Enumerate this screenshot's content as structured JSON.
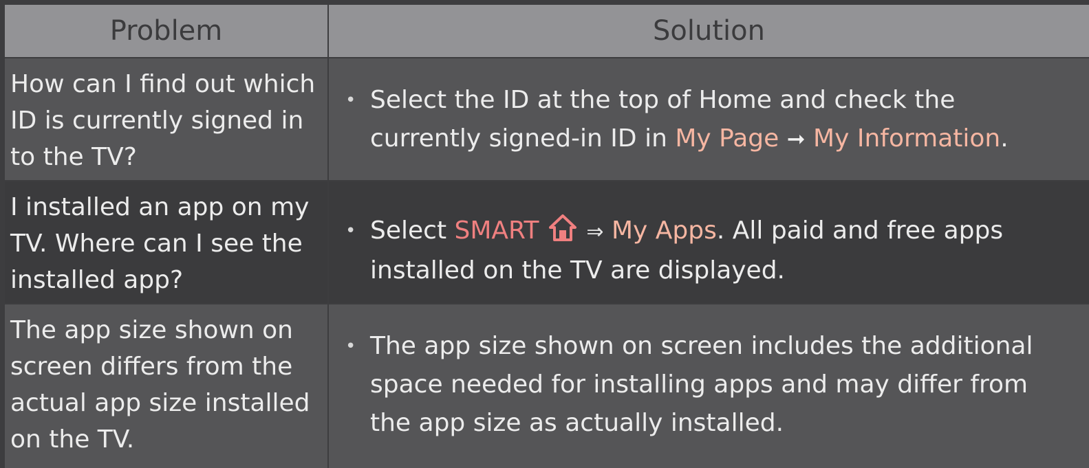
{
  "header": {
    "problem": "Problem",
    "solution": "Solution"
  },
  "rows": [
    {
      "problem": "How can I find out which ID is currently signed in to the TV?",
      "solution": {
        "text1": "Select the ID at the top of Home and check the currently signed-in ID in ",
        "link1": "My Page",
        "arrow": "➞",
        "link2": "My Information",
        "end": "."
      }
    },
    {
      "problem": "I installed an app on my TV. Where can I see the installed app?",
      "solution": {
        "text1": "Select ",
        "smart": "SMART",
        "icon": "home-icon",
        "arrow": "⇒",
        "link": "My Apps",
        "text2": ". All paid and free apps installed on the TV are displayed."
      }
    },
    {
      "problem": "The app size shown on screen differs from the actual app size installed on the TV.",
      "solution": {
        "text": "The app size shown on screen includes the additional space needed for installing apps and may differ from the app size as actually installed."
      }
    }
  ],
  "bullet": "•",
  "colors": {
    "header_bg": "#939396",
    "row_light": "#555557",
    "row_dark": "#3b3b3d",
    "link": "#f6b6a2",
    "smart": "#f08080"
  }
}
